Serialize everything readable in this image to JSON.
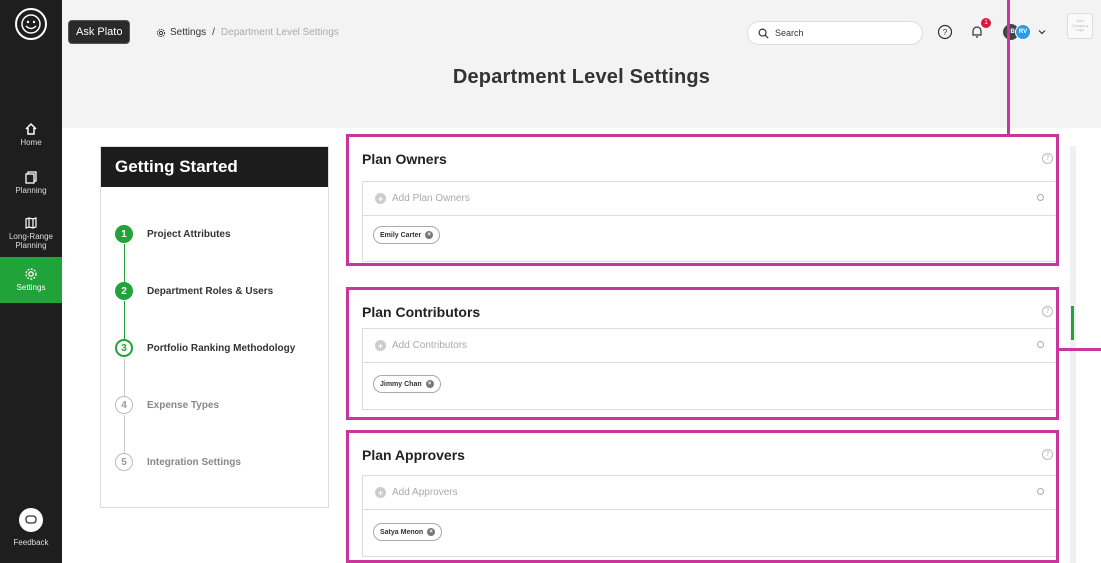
{
  "sidebar": {
    "logo_icon": "plato-face-icon",
    "items": [
      {
        "label": "Home",
        "icon": "home-icon"
      },
      {
        "label": "Planning",
        "icon": "planning-icon"
      },
      {
        "label": "Long-Range Planning",
        "icon": "map-icon"
      },
      {
        "label": "Settings",
        "icon": "gear-icon",
        "active": true
      }
    ],
    "feedback_label": "Feedback"
  },
  "topbar": {
    "ask_plato": "Ask Plato",
    "breadcrumb_root": "Settings",
    "breadcrumb_separator": "/",
    "breadcrumb_current": "Department Level Settings",
    "search_placeholder": "Search",
    "notification_count": "1",
    "avatar_1": "JB",
    "avatar_2": "RV",
    "company_logo": "Add Company Logo"
  },
  "page_title": "Department Level Settings",
  "getting_started": {
    "title": "Getting Started",
    "steps": [
      {
        "number": "1",
        "label": "Project Attributes",
        "state": "done"
      },
      {
        "number": "2",
        "label": "Department Roles & Users",
        "state": "done"
      },
      {
        "number": "3",
        "label": "Portfolio Ranking Methodology",
        "state": "current"
      },
      {
        "number": "4",
        "label": "Expense Types",
        "state": "todo"
      },
      {
        "number": "5",
        "label": "Integration Settings",
        "state": "todo"
      }
    ]
  },
  "cards": [
    {
      "title": "Plan Owners",
      "add_label": "Add Plan Owners",
      "chip": "Emily Carter"
    },
    {
      "title": "Plan Contributors",
      "add_label": "Add Contributors",
      "chip": "Jimmy Chan"
    },
    {
      "title": "Plan Approvers",
      "add_label": "Add Approvers",
      "chip": "Satya Menon"
    }
  ],
  "colors": {
    "accent_green": "#20a339",
    "highlight_magenta": "#c9359b",
    "sidebar_bg": "#1e1e1e"
  }
}
